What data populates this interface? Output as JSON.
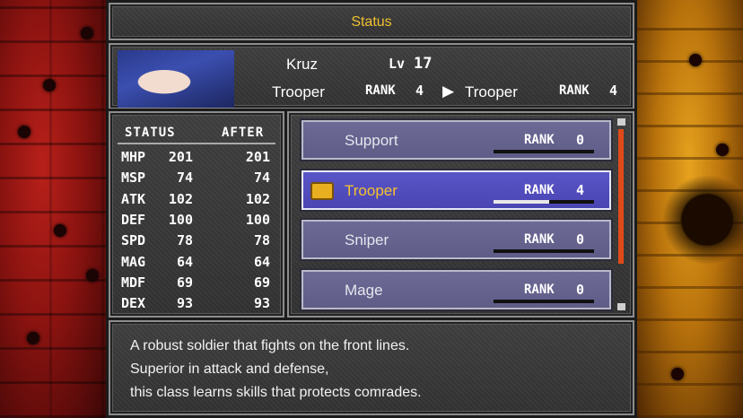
{
  "title": "Status",
  "character": {
    "name": "Kruz",
    "level_label": "Lv",
    "level": "17",
    "current_class": "Trooper",
    "current_rank_label": "RANK",
    "current_rank": "4",
    "arrow": "▶",
    "new_class": "Trooper",
    "new_rank_label": "RANK",
    "new_rank": "4"
  },
  "stats": {
    "header_status": "STATUS",
    "header_after": "AFTER",
    "rows": [
      {
        "name": "MHP",
        "value": "201",
        "after": "201"
      },
      {
        "name": "MSP",
        "value": "74",
        "after": "74"
      },
      {
        "name": "ATK",
        "value": "102",
        "after": "102"
      },
      {
        "name": "DEF",
        "value": "100",
        "after": "100"
      },
      {
        "name": "SPD",
        "value": "78",
        "after": "78"
      },
      {
        "name": "MAG",
        "value": "64",
        "after": "64"
      },
      {
        "name": "MDF",
        "value": "69",
        "after": "69"
      },
      {
        "name": "DEX",
        "value": "93",
        "after": "93"
      }
    ]
  },
  "classes": [
    {
      "name": "Support",
      "rank_label": "RANK",
      "rank": "0",
      "progress": 0,
      "selected": false
    },
    {
      "name": "Trooper",
      "rank_label": "RANK",
      "rank": "4",
      "progress": 0.55,
      "selected": true
    },
    {
      "name": "Sniper",
      "rank_label": "RANK",
      "rank": "0",
      "progress": 0,
      "selected": false
    },
    {
      "name": "Mage",
      "rank_label": "RANK",
      "rank": "0",
      "progress": 0,
      "selected": false
    }
  ],
  "description": {
    "line1": "A robust soldier that fights on the front lines.",
    "line2": "Superior in attack and defense,",
    "line3": "this class learns skills that protects comrades."
  },
  "colors": {
    "title": "#f0c030",
    "selected_text": "#f5c230",
    "scrollbar": "#e04a18"
  }
}
